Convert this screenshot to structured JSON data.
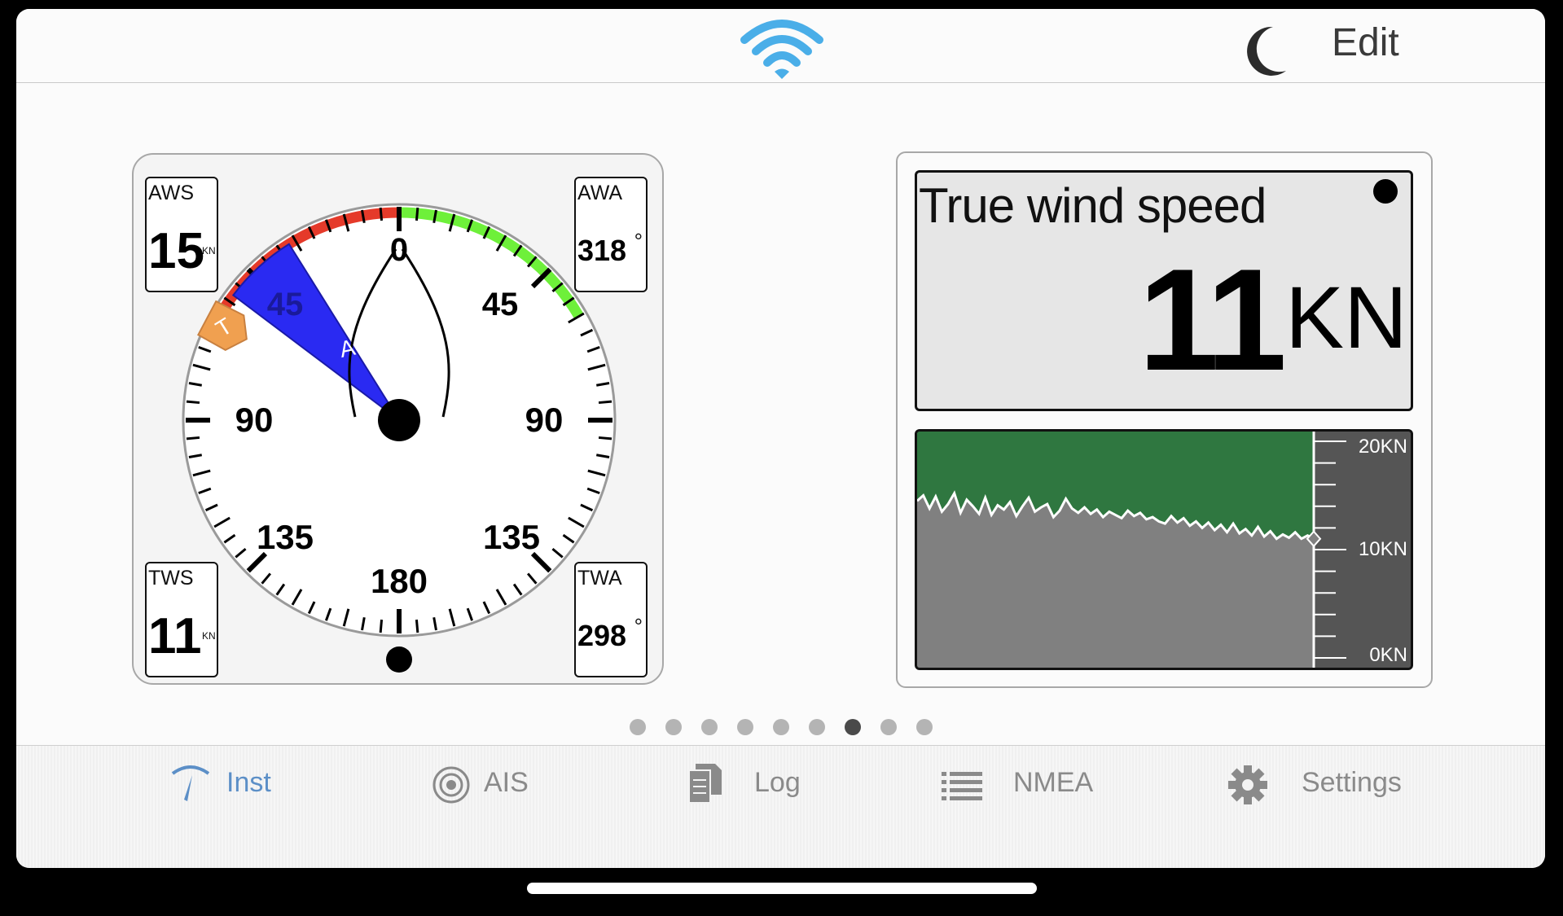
{
  "topbar": {
    "wifi_icon": "wifi-icon",
    "night_mode_icon": "moon-icon",
    "edit_label": "Edit"
  },
  "wind_gauge": {
    "aws": {
      "label": "AWS",
      "value": "15",
      "unit": "KN"
    },
    "awa": {
      "label": "AWA",
      "value": "318",
      "unit": "°"
    },
    "tws": {
      "label": "TWS",
      "value": "11",
      "unit": "KN"
    },
    "twa": {
      "label": "TWA",
      "value": "298",
      "unit": "°"
    },
    "dial_labels": [
      "0",
      "45",
      "90",
      "135",
      "180",
      "135",
      "90",
      "45"
    ],
    "apparent_marker": "A",
    "true_marker": "T",
    "apparent_wind_angle_deg": 318,
    "true_wind_angle_deg": 298,
    "colors": {
      "port": "#e53a2a",
      "starboard": "#6ef03a",
      "apparent": "#2a2af2",
      "true": "#f0a050"
    }
  },
  "true_wind_speed": {
    "title": "True wind speed",
    "value": "11",
    "unit": "KN"
  },
  "history_chart": {
    "scale_labels": [
      "20KN",
      "10KN",
      "0KN"
    ],
    "range": [
      0,
      20
    ],
    "current": 11,
    "colors": {
      "above": "#2f7740",
      "below": "#808080",
      "scale_bg": "#555555",
      "line": "#ffffff"
    }
  },
  "chart_data": {
    "type": "area",
    "title": "",
    "xlabel": "",
    "ylabel": "",
    "ylim": [
      0,
      20
    ],
    "y_tick_labels": [
      "20KN",
      "10KN",
      "0KN"
    ],
    "series": [
      {
        "values": [
          14.5,
          15.0,
          13.8,
          14.9,
          13.5,
          14.2,
          15.2,
          13.4,
          14.6,
          14.0,
          13.3,
          14.8,
          13.2,
          14.1,
          13.7,
          14.4,
          13.1,
          14.0,
          14.8,
          13.5,
          13.9,
          14.2,
          13.0,
          13.6,
          14.7,
          13.8,
          13.4,
          13.9,
          13.3,
          13.7,
          13.0,
          13.5,
          13.2,
          12.9,
          13.6,
          13.1,
          13.4,
          12.8,
          13.0,
          12.6,
          12.4,
          13.1,
          12.5,
          12.9,
          12.2,
          12.6,
          12.0,
          12.5,
          11.8,
          12.3,
          11.6,
          12.4,
          11.5,
          11.9,
          11.3,
          12.1,
          11.2,
          11.7,
          11.0,
          11.4,
          11.1,
          11.6,
          11.0,
          11.3,
          11.0
        ]
      }
    ]
  },
  "pager": {
    "count": 9,
    "active_index": 6
  },
  "tabbar": {
    "tabs": [
      {
        "label": "Inst",
        "icon": "gauge-icon",
        "active": true
      },
      {
        "label": "AIS",
        "icon": "radar-icon",
        "active": false
      },
      {
        "label": "Log",
        "icon": "document-icon",
        "active": false
      },
      {
        "label": "NMEA",
        "icon": "list-icon",
        "active": false
      },
      {
        "label": "Settings",
        "icon": "gear-icon",
        "active": false
      }
    ]
  }
}
